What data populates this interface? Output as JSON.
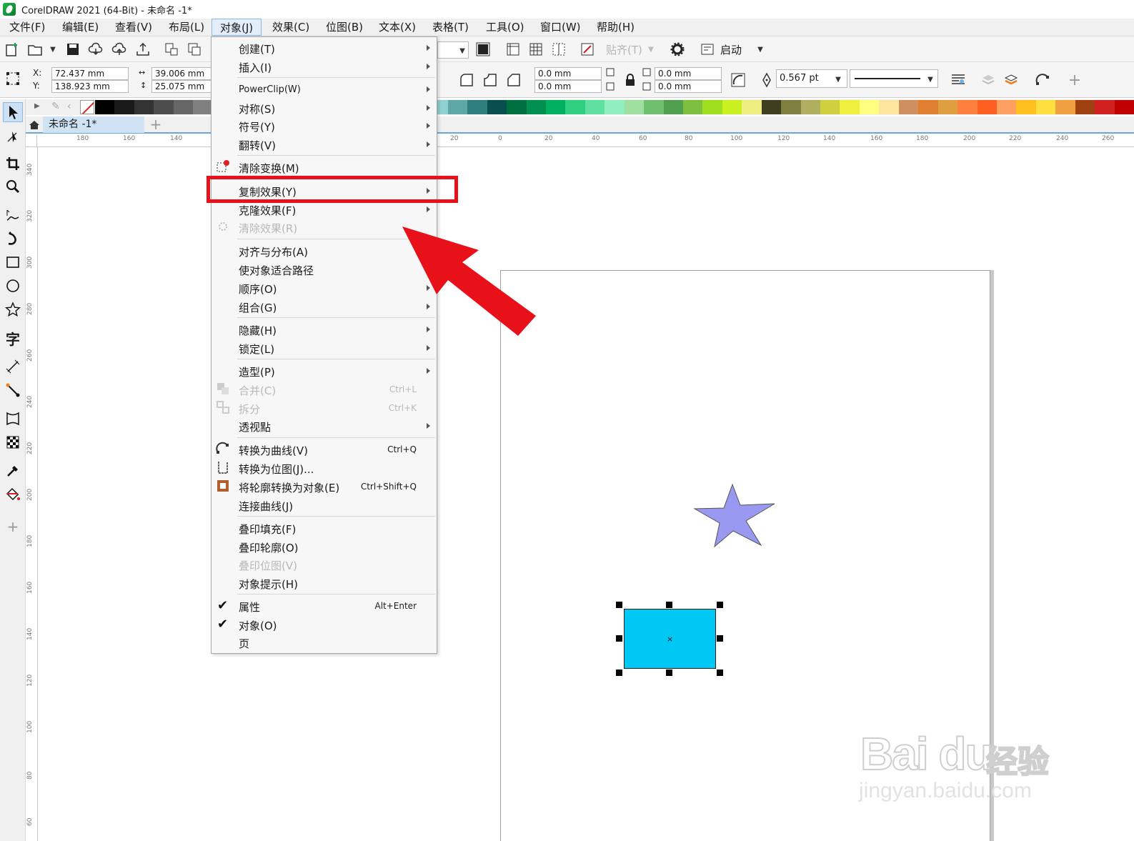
{
  "window": {
    "title": "CorelDRAW 2021 (64-Bit) - 未命名 -1*"
  },
  "menubar": {
    "items": [
      "文件(F)",
      "编辑(E)",
      "查看(V)",
      "布局(L)",
      "对象(J)",
      "效果(C)",
      "位图(B)",
      "文本(X)",
      "表格(T)",
      "工具(O)",
      "窗口(W)",
      "帮助(H)"
    ],
    "active": "对象(J)"
  },
  "toolbar": {
    "snap_label": "贴齐(T)",
    "launch_label": "启动",
    "x_label": "X:",
    "y_label": "Y:",
    "x_value": "72.437 mm",
    "y_value": "138.923 mm",
    "width_value": "39.006 mm",
    "height_value": "25.075 mm",
    "corner_values": [
      "0.0 mm",
      "0.0 mm",
      "0.0 mm",
      "0.0 mm"
    ],
    "outline_width": "0.567 pt"
  },
  "document": {
    "tab_label": "未命名 -1*"
  },
  "rulers": {
    "horizontal": [
      "180",
      "160",
      "140",
      "20",
      "0",
      "20",
      "40",
      "60",
      "80",
      "100",
      "120",
      "140",
      "160",
      "180",
      "200",
      "220",
      "240",
      "260"
    ],
    "vertical": [
      "340",
      "320",
      "300",
      "280",
      "260",
      "240",
      "220",
      "200",
      "180",
      "160",
      "140",
      "120",
      "100",
      "80",
      "60"
    ]
  },
  "palette": {
    "colors": [
      "#000000",
      "#1a1a1a",
      "#333333",
      "#4d4d4d",
      "#666666",
      "#808080",
      "#999999",
      "#b3b3b3",
      "#cccccc",
      "#6b8cff",
      "#5b5bef",
      "#3b3bcf",
      "#2a2a9f",
      "#10107f",
      "#1e3f8f",
      "#00c8f4",
      "#7fe6f8",
      "#8fd0d0",
      "#5fa8a8",
      "#2f7f7f",
      "#0a4f4f",
      "#006f3f",
      "#008f4f",
      "#00af5f",
      "#2fcf7f",
      "#5fe0a0",
      "#8fefbf",
      "#9fdf9f",
      "#6fbf6f",
      "#4f9f4f",
      "#7fbf3f",
      "#9fdf1f",
      "#c9f01f",
      "#efef7f",
      "#3f3f1f",
      "#7f7f3f",
      "#afaf5f",
      "#cfcf3f",
      "#efef3f",
      "#ffff7f",
      "#ffe69f",
      "#cf8f5f",
      "#df7f2f",
      "#df9f3f",
      "#ff7f3f",
      "#ff5f1f",
      "#ff9f5f",
      "#ffbf1f",
      "#ffdf3f",
      "#f0a040",
      "#a04010",
      "#d02020",
      "#c00000"
    ]
  },
  "context_menu": {
    "items": [
      {
        "label": "创建(T)",
        "submenu": true
      },
      {
        "label": "插入(I)",
        "submenu": true
      },
      {
        "label": "PowerClip(W)",
        "submenu": true
      },
      {
        "label": "对称(S)",
        "submenu": true
      },
      {
        "label": "符号(Y)",
        "submenu": true
      },
      {
        "label": "翻转(V)",
        "submenu": true
      },
      {
        "label": "清除变换(M)",
        "icon": "clear-transform-icon"
      },
      {
        "label": "复制效果(Y)",
        "submenu": true,
        "highlighted": true
      },
      {
        "label": "克隆效果(F)",
        "submenu": true
      },
      {
        "label": "清除效果(R)",
        "disabled": true,
        "icon": "clear-effect-icon"
      },
      {
        "label": "对齐与分布(A)"
      },
      {
        "label": "使对象适合路径"
      },
      {
        "label": "顺序(O)",
        "submenu": true
      },
      {
        "label": "组合(G)",
        "submenu": true
      },
      {
        "label": "隐藏(H)",
        "submenu": true
      },
      {
        "label": "锁定(L)",
        "submenu": true
      },
      {
        "label": "造型(P)",
        "submenu": true
      },
      {
        "label": "合并(C)",
        "shortcut": "Ctrl+L",
        "disabled": true,
        "icon": "combine-icon"
      },
      {
        "label": "拆分",
        "shortcut": "Ctrl+K",
        "disabled": true,
        "icon": "break-apart-icon"
      },
      {
        "label": "透视點",
        "submenu": true
      },
      {
        "label": "转换为曲线(V)",
        "shortcut": "Ctrl+Q",
        "icon": "convert-to-curves-icon"
      },
      {
        "label": "转换为位图(J)...",
        "icon": "convert-to-bitmap-icon"
      },
      {
        "label": "将轮廓转换为对象(E)",
        "shortcut": "Ctrl+Shift+Q",
        "icon": "outline-to-object-icon"
      },
      {
        "label": "连接曲线(J)"
      },
      {
        "label": "叠印填充(F)"
      },
      {
        "label": "叠印轮廓(O)"
      },
      {
        "label": "叠印位图(V)",
        "disabled": true
      },
      {
        "label": "对象提示(H)"
      },
      {
        "label": "属性",
        "shortcut": "Alt+Enter",
        "checked": true
      },
      {
        "label": "对象(O)",
        "checked": true
      },
      {
        "label": "页"
      }
    ]
  },
  "canvas_objects": {
    "star_color": "#9999f2",
    "rect_color": "#00c8f4",
    "rect_center_mark": "×"
  },
  "annotation": {
    "highlight_color": "#e8111a"
  },
  "watermark": {
    "brand": "Bai du",
    "cn": "经验",
    "url": "jingyan.baidu.com"
  }
}
